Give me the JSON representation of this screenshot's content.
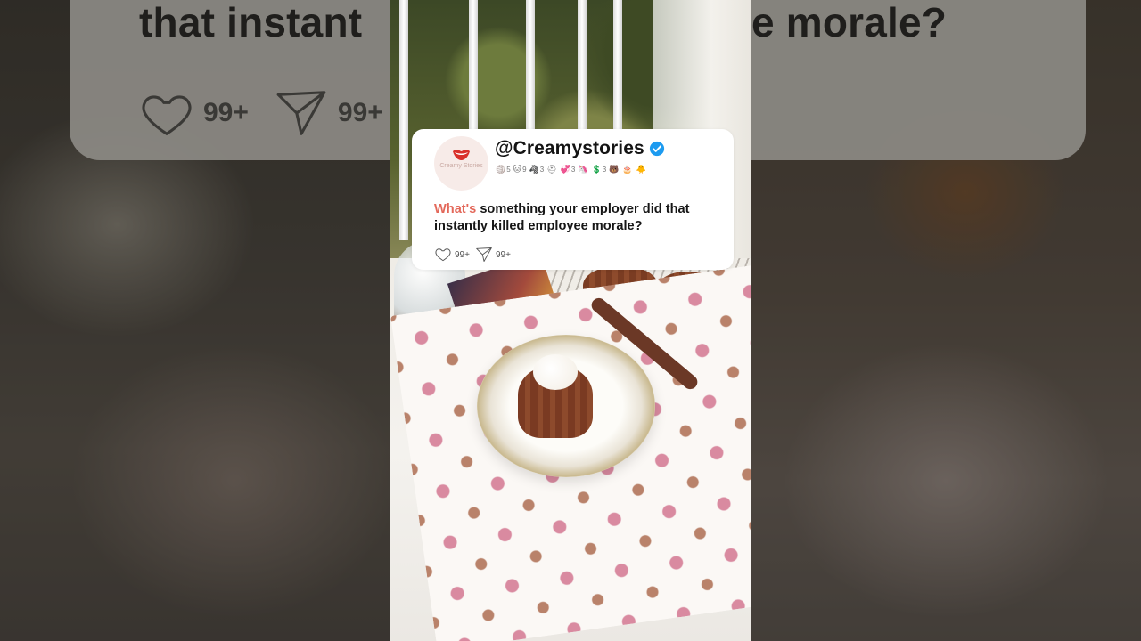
{
  "post": {
    "handle": "@Creamystories",
    "avatar_text": "Creamy Stories",
    "question_highlight": "What's",
    "question_rest": " something your employer did that instantly killed employee morale?",
    "likes": "99+",
    "shares": "99+",
    "badges": [
      {
        "icon": "🏐",
        "count": "5"
      },
      {
        "icon": "🐱",
        "count": "9"
      },
      {
        "icon": "🦓",
        "count": "3"
      },
      {
        "icon": "⛑",
        "count": ""
      },
      {
        "icon": "💞",
        "count": "3"
      },
      {
        "icon": "🦄",
        "count": ""
      },
      {
        "icon": "💲",
        "count": "3"
      },
      {
        "icon": "🐻",
        "count": ""
      },
      {
        "icon": "🎂",
        "count": ""
      },
      {
        "icon": "🐥",
        "count": ""
      }
    ]
  },
  "ghost": {
    "text_left": "that instant",
    "text_right": "e morale?",
    "likes": "99+",
    "shares": "99+"
  },
  "colors": {
    "highlight": "#e3685a",
    "verified": "#1d9bf0",
    "card_bg": "#ffffff"
  },
  "icons": [
    "heart-icon",
    "paper-plane-icon",
    "verified-badge-icon",
    "lips-logo-icon"
  ]
}
